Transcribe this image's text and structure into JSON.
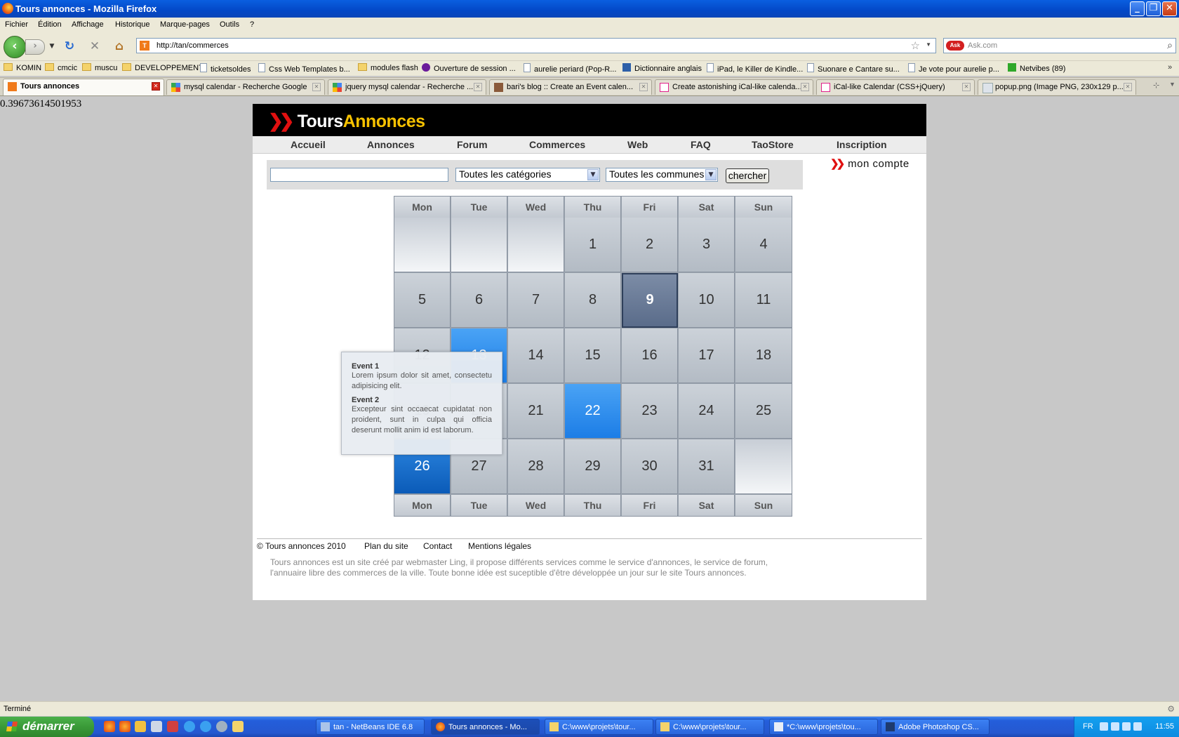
{
  "window": {
    "title": "Tours annonces - Mozilla Firefox"
  },
  "menu": [
    "Fichier",
    "Édition",
    "Affichage",
    "Historique",
    "Marque-pages",
    "Outils",
    "?"
  ],
  "nav": {
    "url": "http://tan/commerces",
    "search_placeholder": "Ask.com",
    "search_engine_icon": "ask-icon"
  },
  "bookmarks": [
    {
      "label": "KOMIN",
      "icon": "folder"
    },
    {
      "label": "cmcic",
      "icon": "folder"
    },
    {
      "label": "muscu",
      "icon": "folder"
    },
    {
      "label": "DEVELOPPEMENT",
      "icon": "folder"
    },
    {
      "label": "ticketsoldes",
      "icon": "page"
    },
    {
      "label": "Css Web Templates b...",
      "icon": "page"
    },
    {
      "label": "modules flash",
      "icon": "folder"
    },
    {
      "label": "Ouverture de session ...",
      "icon": "yahoo"
    },
    {
      "label": "aurelie periard (Pop-R...",
      "icon": "page"
    },
    {
      "label": "Dictionnaire anglais",
      "icon": "w"
    },
    {
      "label": "iPad, le Killer de Kindle...",
      "icon": "page"
    },
    {
      "label": "Suonare e Cantare su...",
      "icon": "page"
    },
    {
      "label": "Je vote pour aurelie p...",
      "icon": "page"
    },
    {
      "label": "Netvibes (89)",
      "icon": "plus"
    }
  ],
  "tabs": [
    {
      "label": "Tours annonces",
      "active": true
    },
    {
      "label": "mysql calendar - Recherche Google"
    },
    {
      "label": "jquery mysql calendar - Recherche ..."
    },
    {
      "label": "bari's blog :: Create an Event calen..."
    },
    {
      "label": "Create astonishing iCal-like calenda..."
    },
    {
      "label": "iCal-like Calendar (CSS+jQuery)"
    },
    {
      "label": "popup.png (Image PNG, 230x129 p..."
    }
  ],
  "debug_value": "0.39673614501953",
  "site": {
    "logo_part1": "Tours",
    "logo_part2": "Annonces",
    "menu": [
      "Accueil",
      "Annonces",
      "Forum",
      "Commerces",
      "Web",
      "FAQ",
      "TaoStore",
      "Inscription"
    ],
    "search": {
      "input_value": "",
      "category_select": "Toutes les catégories",
      "town_select": "Toutes les communes",
      "button": "chercher"
    },
    "account_link": "mon compte"
  },
  "calendar": {
    "weekdays": [
      "Mon",
      "Tue",
      "Wed",
      "Thu",
      "Fri",
      "Sat",
      "Sun"
    ],
    "weeks": [
      [
        "",
        "",
        "",
        "1",
        "2",
        "3",
        "4"
      ],
      [
        "5",
        "6",
        "7",
        "8",
        "9",
        "10",
        "11"
      ],
      [
        "12",
        "13",
        "14",
        "15",
        "16",
        "17",
        "18"
      ],
      [
        "19",
        "20",
        "21",
        "22",
        "23",
        "24",
        "25"
      ],
      [
        "26",
        "27",
        "28",
        "29",
        "30",
        "31",
        ""
      ]
    ],
    "today": "9",
    "event_days": [
      "13",
      "22",
      "26"
    ],
    "popup": {
      "events": [
        {
          "title": "Event 1",
          "desc": "Lorem ipsum dolor sit amet, consectetu adipisicing elit."
        },
        {
          "title": "Event 2",
          "desc": "Excepteur sint occaecat cupidatat non proident, sunt in culpa qui officia deserunt mollit anim id est laborum."
        }
      ]
    }
  },
  "footer": {
    "copyright": "© Tours annonces 2010",
    "links": [
      "Plan du site",
      "Contact",
      "Mentions légales"
    ],
    "text": "Tours annonces est un site créé par webmaster Ling, il propose différents services comme le service d'annonces, le service de forum, l'annuaire libre des commerces de la ville. Toute bonne idée est suceptible d'être développée un jour sur le site Tours annonces."
  },
  "status": "Terminé",
  "taskbar": {
    "start": "démarrer",
    "tasks": [
      {
        "label": "tan - NetBeans IDE 6.8"
      },
      {
        "label": "Tours annonces - Mo...",
        "active": true
      },
      {
        "label": "C:\\www\\projets\\tour..."
      },
      {
        "label": "C:\\www\\projets\\tour..."
      },
      {
        "label": "*C:\\www\\projets\\tou..."
      },
      {
        "label": "Adobe Photoshop CS..."
      }
    ],
    "tray_lang": "FR",
    "clock": "11:55"
  }
}
